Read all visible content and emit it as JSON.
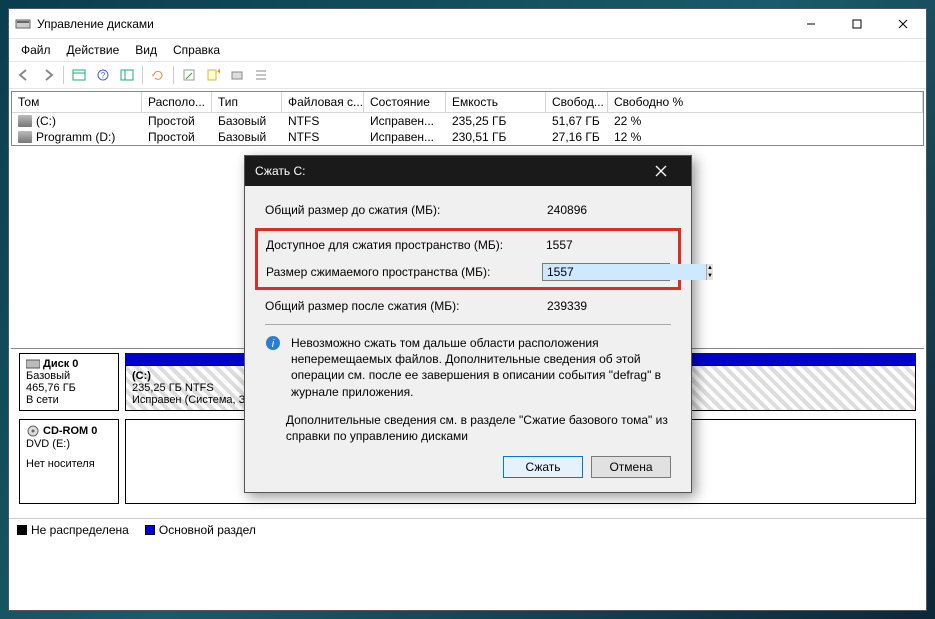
{
  "window": {
    "title": "Управление дисками"
  },
  "menu": {
    "file": "Файл",
    "action": "Действие",
    "view": "Вид",
    "help": "Справка"
  },
  "columns": {
    "volume": "Том",
    "layout": "Располо...",
    "type": "Тип",
    "fs": "Файловая с...",
    "status": "Состояние",
    "capacity": "Емкость",
    "free": "Свобод...",
    "freepct": "Свободно %"
  },
  "rows": [
    {
      "volume": "(C:)",
      "layout": "Простой",
      "type": "Базовый",
      "fs": "NTFS",
      "status": "Исправен...",
      "capacity": "235,25 ГБ",
      "free": "51,67 ГБ",
      "freepct": "22 %"
    },
    {
      "volume": "Programm (D:)",
      "layout": "Простой",
      "type": "Базовый",
      "fs": "NTFS",
      "status": "Исправен...",
      "capacity": "230,51 ГБ",
      "free": "27,16 ГБ",
      "freepct": "12 %"
    }
  ],
  "disk0": {
    "title": "Диск 0",
    "type": "Базовый",
    "size": "465,76 ГБ",
    "online": "В сети",
    "part_name": "(C:)",
    "part_line1": "235,25 ГБ NTFS",
    "part_line2": "Исправен (Система, З"
  },
  "cdrom": {
    "title": "CD-ROM 0",
    "line1": "DVD (E:)",
    "line2": "Нет носителя"
  },
  "legend": {
    "unalloc": "Не распределена",
    "primary": "Основной раздел"
  },
  "dialog": {
    "title": "Сжать C:",
    "label_total_before": "Общий размер до сжатия (МБ):",
    "val_total_before": "240896",
    "label_available": "Доступное для сжатия пространство (МБ):",
    "val_available": "1557",
    "label_shrink": "Размер сжимаемого пространства (МБ):",
    "val_shrink": "1557",
    "label_total_after": "Общий размер после сжатия (МБ):",
    "val_total_after": "239339",
    "info1": "Невозможно сжать том дальше области расположения неперемещаемых файлов. Дополнительные сведения об этой операции см. после ее завершения в описании события \"defrag\" в журнале приложения.",
    "info2": "Дополнительные сведения см. в разделе \"Сжатие базового тома\" из справки по управлению дисками",
    "btn_shrink": "Сжать",
    "btn_cancel": "Отмена"
  }
}
